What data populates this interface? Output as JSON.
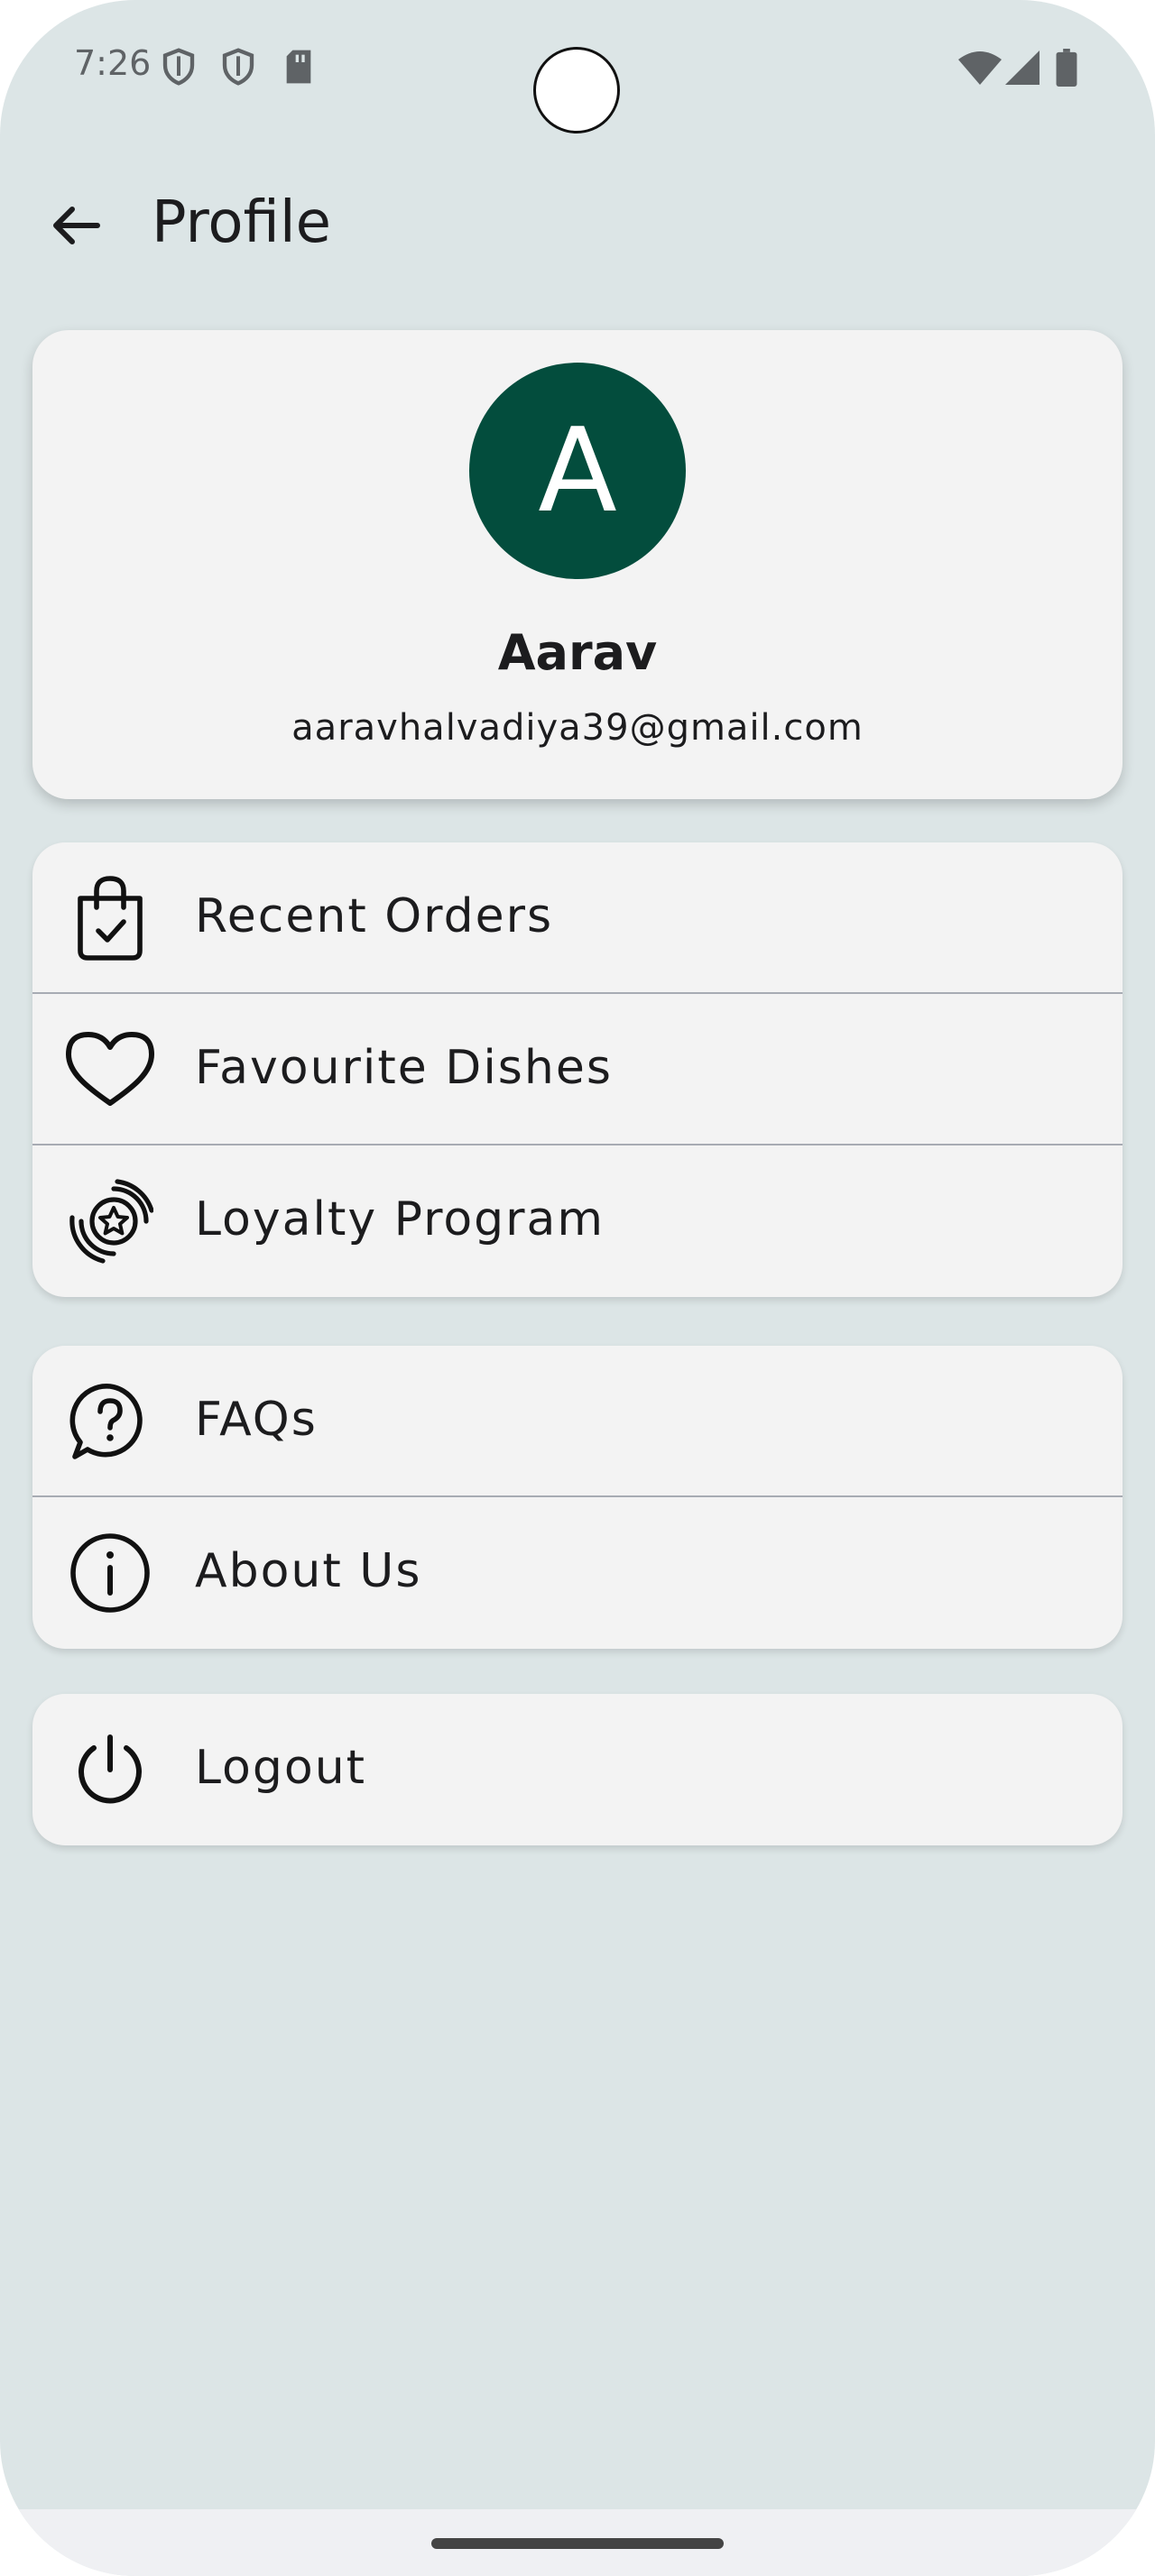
{
  "status_bar": {
    "time": "7:26",
    "icons_left": [
      "shield-icon",
      "shield-icon",
      "sd-card-icon"
    ],
    "icons_right": [
      "wifi-icon",
      "signal-icon",
      "battery-icon"
    ]
  },
  "app_bar": {
    "title": "Profile",
    "back_icon": "arrow-back-icon"
  },
  "profile": {
    "avatar_letter": "A",
    "avatar_color": "#034d3d",
    "name": "Aarav",
    "email": "aaravhalvadiya39@gmail.com"
  },
  "menu_groups": [
    {
      "items": [
        {
          "label": "Recent Orders",
          "icon": "shopping-bag-check-icon"
        },
        {
          "label": "Favourite Dishes",
          "icon": "heart-icon"
        },
        {
          "label": "Loyalty Program",
          "icon": "star-badge-icon"
        }
      ]
    },
    {
      "items": [
        {
          "label": "FAQs",
          "icon": "question-chat-icon"
        },
        {
          "label": "About Us",
          "icon": "info-icon"
        }
      ]
    },
    {
      "items": [
        {
          "label": "Logout",
          "icon": "power-icon"
        }
      ]
    }
  ],
  "colors": {
    "background": "#dce5e6",
    "card": "#f3f3f3",
    "divider": "#a7abb3",
    "text": "#1c1c1e"
  }
}
